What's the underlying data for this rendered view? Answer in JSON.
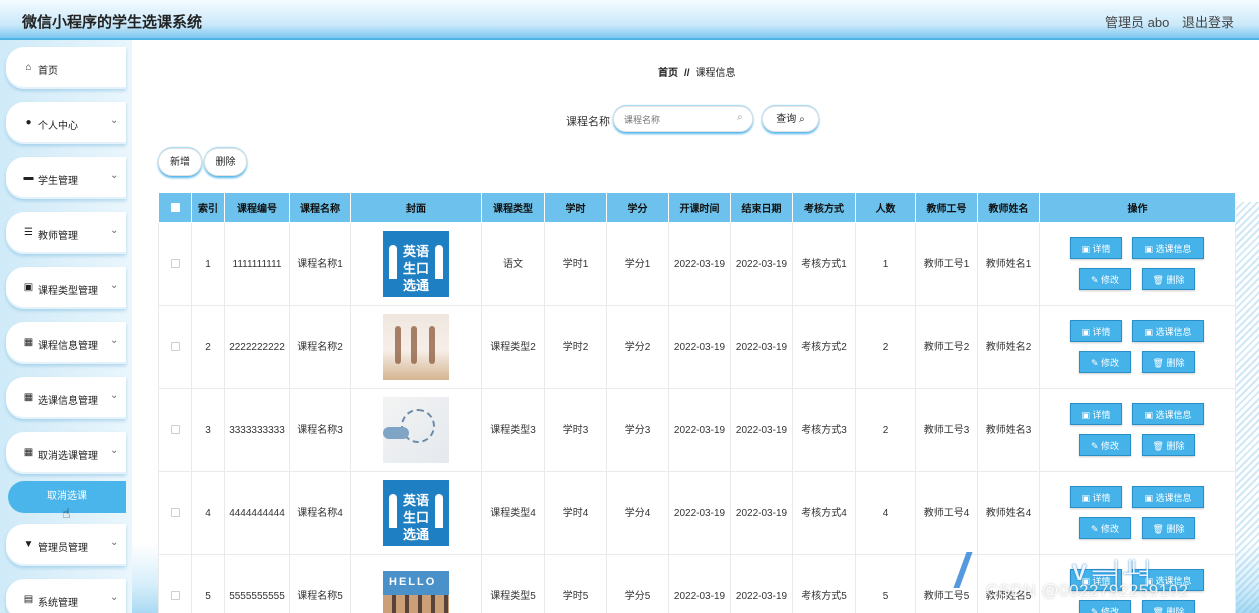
{
  "header": {
    "title": "微信小程序的学生选课系统",
    "user_label": "管理员 abo",
    "logout_label": "退出登录"
  },
  "sidebar": {
    "items": [
      {
        "label": "首页",
        "icon": "home-icon",
        "has_chevron": false
      },
      {
        "label": "个人中心",
        "icon": "user-icon",
        "has_chevron": true
      },
      {
        "label": "学生管理",
        "icon": "briefcase-icon",
        "has_chevron": true
      },
      {
        "label": "教师管理",
        "icon": "sliders-icon",
        "has_chevron": true
      },
      {
        "label": "课程类型管理",
        "icon": "clipboard-icon",
        "has_chevron": true
      },
      {
        "label": "课程信息管理",
        "icon": "grid-icon",
        "has_chevron": true
      },
      {
        "label": "选课信息管理",
        "icon": "grid-icon",
        "has_chevron": true
      },
      {
        "label": "取消选课管理",
        "icon": "grid-icon",
        "has_chevron": true
      },
      {
        "label": "管理员管理",
        "icon": "message-icon",
        "has_chevron": true
      },
      {
        "label": "系统管理",
        "icon": "document-icon",
        "has_chevron": true
      }
    ],
    "active_sub_item": "取消选课"
  },
  "breadcrumb": {
    "home": "首页",
    "separator": "//",
    "current": "课程信息"
  },
  "search": {
    "label": "课程名称",
    "placeholder": "课程名称",
    "query_button": "查询"
  },
  "toolbar": {
    "add_label": "新增",
    "delete_label": "删除"
  },
  "table": {
    "columns": [
      "索引",
      "课程编号",
      "课程名称",
      "封面",
      "课程类型",
      "学时",
      "学分",
      "开课时间",
      "结束日期",
      "考核方式",
      "人数",
      "教师工号",
      "教师姓名",
      "操作"
    ],
    "actions": {
      "detail": "详情",
      "select_info": "选课信息",
      "edit": "修改",
      "delete": "删除"
    },
    "rows": [
      {
        "index": "1",
        "code": "1111111111",
        "name": "课程名称1",
        "cover": "english",
        "type": "语文",
        "hours": "学时1",
        "credit": "学分1",
        "start": "2022-03-19",
        "end": "2022-03-19",
        "exam": "考核方式1",
        "count": "1",
        "teacher_id": "教师工号1",
        "teacher_name": "教师姓名1"
      },
      {
        "index": "2",
        "code": "2222222222",
        "name": "课程名称2",
        "cover": "dance",
        "type": "课程类型2",
        "hours": "学时2",
        "credit": "学分2",
        "start": "2022-03-19",
        "end": "2022-03-19",
        "exam": "考核方式2",
        "count": "2",
        "teacher_id": "教师工号2",
        "teacher_name": "教师姓名2"
      },
      {
        "index": "3",
        "code": "3333333333",
        "name": "课程名称3",
        "cover": "business",
        "type": "课程类型3",
        "hours": "学时3",
        "credit": "学分3",
        "start": "2022-03-19",
        "end": "2022-03-19",
        "exam": "考核方式3",
        "count": "2",
        "teacher_id": "教师工号3",
        "teacher_name": "教师姓名3"
      },
      {
        "index": "4",
        "code": "4444444444",
        "name": "课程名称4",
        "cover": "english",
        "type": "课程类型4",
        "hours": "学时4",
        "credit": "学分4",
        "start": "2022-03-19",
        "end": "2022-03-19",
        "exam": "考核方式4",
        "count": "4",
        "teacher_id": "教师工号4",
        "teacher_name": "教师姓名4"
      },
      {
        "index": "5",
        "code": "5555555555",
        "name": "课程名称5",
        "cover": "hello",
        "type": "课程类型5",
        "hours": "学时5",
        "credit": "学分5",
        "start": "2022-03-19",
        "end": "2022-03-19",
        "exam": "考核方式5",
        "count": "5",
        "teacher_id": "教师工号5",
        "teacher_name": "教师姓名5"
      }
    ]
  },
  "cover_texts": {
    "english": "英语\n生口\n选通",
    "hello": "HELLO"
  },
  "watermark": "CSDN @0022792259102",
  "colors": {
    "accent": "#45b3ea",
    "header_bg": "#6cc2ec"
  }
}
